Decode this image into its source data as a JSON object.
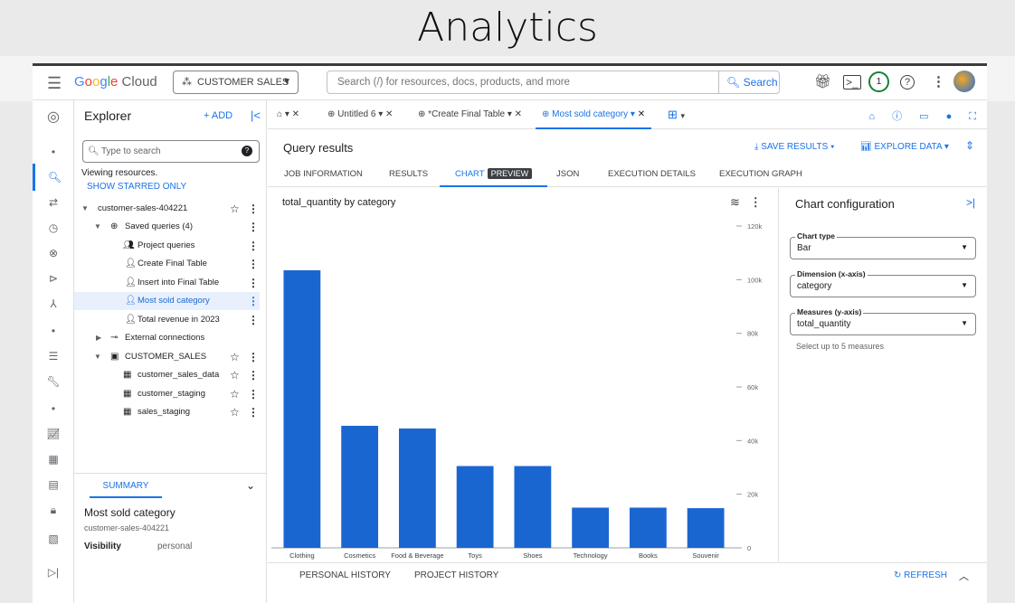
{
  "page_title": "Analytics",
  "topbar": {
    "logo": "Google Cloud",
    "project": "CUSTOMER SALES",
    "search_placeholder": "Search (/) for resources, docs, products, and more",
    "search_button": "Search",
    "notifications_count": "1"
  },
  "explorer": {
    "title": "Explorer",
    "add_label": "ADD",
    "search_placeholder": "Type to search",
    "viewing": "Viewing resources.",
    "show_starred": "SHOW STARRED ONLY",
    "tree": [
      {
        "label": "customer-sales-404221"
      },
      {
        "label": "Saved queries (4)"
      },
      {
        "label": "Project queries"
      },
      {
        "label": "Create Final Table"
      },
      {
        "label": "Insert into Final Table"
      },
      {
        "label": "Most sold category"
      },
      {
        "label": "Total revenue in 2023"
      },
      {
        "label": "External connections"
      },
      {
        "label": "CUSTOMER_SALES"
      },
      {
        "label": "customer_sales_data"
      },
      {
        "label": "customer_staging"
      },
      {
        "label": "sales_staging"
      }
    ],
    "summary_tab": "SUMMARY",
    "summary_name": "Most sold category",
    "summary_project": "customer-sales-404221",
    "visibility_label": "Visibility",
    "visibility_value": "personal"
  },
  "tabs": [
    {
      "label": "Untitled 6"
    },
    {
      "label": "*Create Final Table"
    },
    {
      "label": "Most sold category"
    }
  ],
  "results": {
    "title": "Query results",
    "save_results": "SAVE RESULTS",
    "explore_data": "EXPLORE DATA",
    "tabs": [
      "JOB INFORMATION",
      "RESULTS",
      "CHART",
      "JSON",
      "EXECUTION DETAILS",
      "EXECUTION GRAPH"
    ],
    "preview_badge": "PREVIEW"
  },
  "chart_config": {
    "title": "Chart configuration",
    "chart_type_label": "Chart type",
    "chart_type": "Bar",
    "dimension_label": "Dimension (x-axis)",
    "dimension": "category",
    "measures_label": "Measures (y-axis)",
    "measures": "total_quantity",
    "hint": "Select up to 5 measures"
  },
  "history": {
    "personal": "PERSONAL HISTORY",
    "project": "PROJECT HISTORY",
    "refresh": "REFRESH"
  },
  "colors": {
    "accent": "#1a73e8",
    "bar": "#1a66d1"
  },
  "chart_data": {
    "type": "bar",
    "title": "total_quantity by category",
    "categories": [
      "Clothing",
      "Cosmetics",
      "Food & Beverage",
      "Toys",
      "Shoes",
      "Technology",
      "Books",
      "Souvenir"
    ],
    "values": [
      103500,
      45500,
      44500,
      30500,
      30500,
      15000,
      15000,
      14800
    ],
    "yticks": [
      "0",
      "20k",
      "40k",
      "60k",
      "80k",
      "100k",
      "120k"
    ],
    "ylim": [
      0,
      120000
    ],
    "grid": false
  }
}
